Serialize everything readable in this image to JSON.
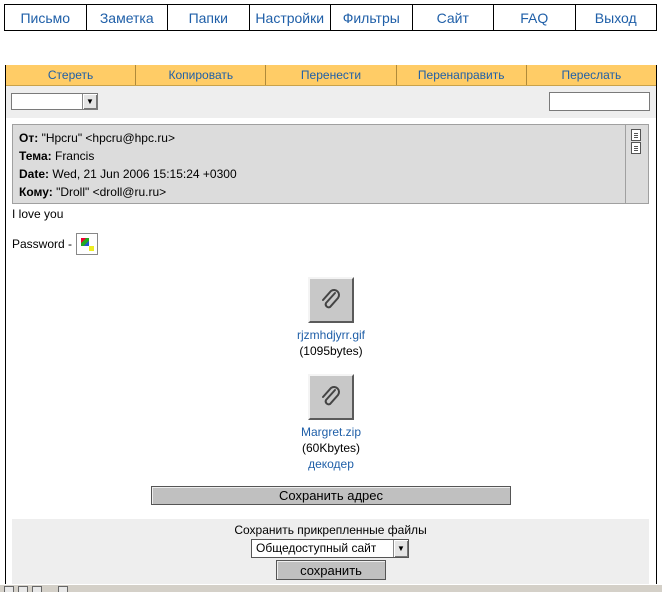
{
  "topnav": [
    {
      "label": "Письмо"
    },
    {
      "label": "Заметка"
    },
    {
      "label": "Папки"
    },
    {
      "label": "Настройки"
    },
    {
      "label": "Фильтры"
    },
    {
      "label": "Сайт"
    },
    {
      "label": "FAQ"
    },
    {
      "label": "Выход"
    }
  ],
  "actions": [
    {
      "label": "Стереть"
    },
    {
      "label": "Копировать"
    },
    {
      "label": "Перенести"
    },
    {
      "label": "Перенаправить"
    },
    {
      "label": "Переслать"
    }
  ],
  "toolbar": {
    "folder_select_value": "",
    "search_value": ""
  },
  "message": {
    "from_label": "От:",
    "from_value": "\"Hpcru\" <hpcru@hpc.ru>",
    "subject_label": "Тема:",
    "subject_value": "Francis",
    "date_label": "Date:",
    "date_value": "Wed, 21 Jun 2006 15:15:24 +0300",
    "to_label": "Кому:",
    "to_value": "\"Droll\" <droll@ru.ru>",
    "body_line1": "I love you",
    "body_password": "Password -"
  },
  "attachments": [
    {
      "name": "rjzmhdjyrr.gif",
      "size": "(1095bytes)"
    },
    {
      "name": "Margret.zip",
      "size": "(60Kbytes)",
      "extra": "декодер"
    }
  ],
  "save_address_label": "Сохранить адрес",
  "save_panel": {
    "title": "Сохранить прикрепленные файлы",
    "select_value": "Общедоступный сайт",
    "button_label": "сохранить"
  },
  "colors": {
    "accent_bar": "#ffcc66",
    "link": "#1f5fa8",
    "header_bg": "#dcdcdc"
  }
}
